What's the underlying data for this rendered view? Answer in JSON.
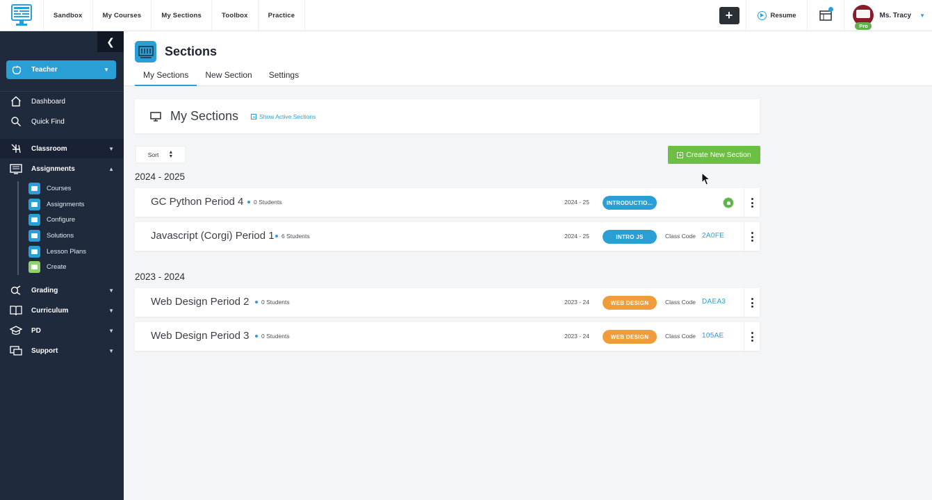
{
  "topnav": {
    "items": [
      "Sandbox",
      "My Courses",
      "My Sections",
      "Toolbox",
      "Practice"
    ],
    "add_label": "+",
    "resume_label": "Resume",
    "user_name": "Ms. Tracy",
    "pro_label": "Pro"
  },
  "sidebar": {
    "role": "Teacher",
    "items": [
      {
        "label": "Dashboard",
        "icon": "home-icon"
      },
      {
        "label": "Quick Find",
        "icon": "search-icon"
      },
      {
        "label": "Classroom",
        "icon": "classroom-icon"
      },
      {
        "label": "Assignments",
        "icon": "assignments-icon"
      },
      {
        "label": "Grading",
        "icon": "grading-icon"
      },
      {
        "label": "Curriculum",
        "icon": "book-icon"
      },
      {
        "label": "PD",
        "icon": "graduation-cap-icon"
      },
      {
        "label": "Support",
        "icon": "support-icon"
      }
    ],
    "sub_items": [
      "Courses",
      "Assignments",
      "Configure",
      "Solutions",
      "Lesson Plans",
      "Create"
    ]
  },
  "header": {
    "title": "Sections",
    "tabs": [
      "My Sections",
      "New Section",
      "Settings"
    ]
  },
  "main": {
    "card_title": "My Sections",
    "show_active": "Show Active Sections",
    "sort_label": "Sort",
    "create_label": "Create New Section",
    "class_code_label": "Class Code"
  },
  "groups": [
    {
      "year": "2024 - 2025",
      "sections": [
        {
          "name": "GC Python Period 4",
          "students": "0 Students",
          "year": "2024 - 25",
          "course": "INTRODUCTIO...",
          "code": ""
        },
        {
          "name": "Javascript (Corgi) Period 1",
          "students": "6 Students",
          "year": "2024 - 25",
          "course": "INTRO JS",
          "code": "2A0FE"
        }
      ]
    },
    {
      "year": "2023 - 2024",
      "sections": [
        {
          "name": "Web Design Period 2",
          "students": "0 Students",
          "year": "2023 - 24",
          "course": "WEB DESIGN",
          "code": "DAEA3"
        },
        {
          "name": "Web Design Period 3",
          "students": "0 Students",
          "year": "2023 - 24",
          "course": "WEB DESIGN",
          "code": "105AE"
        }
      ]
    }
  ],
  "colors": {
    "accent": "#2a9fd6",
    "sidebar_bg": "#1f2a3c",
    "create_green": "#6cbe45",
    "badge_orange": "#ef9d3b"
  }
}
